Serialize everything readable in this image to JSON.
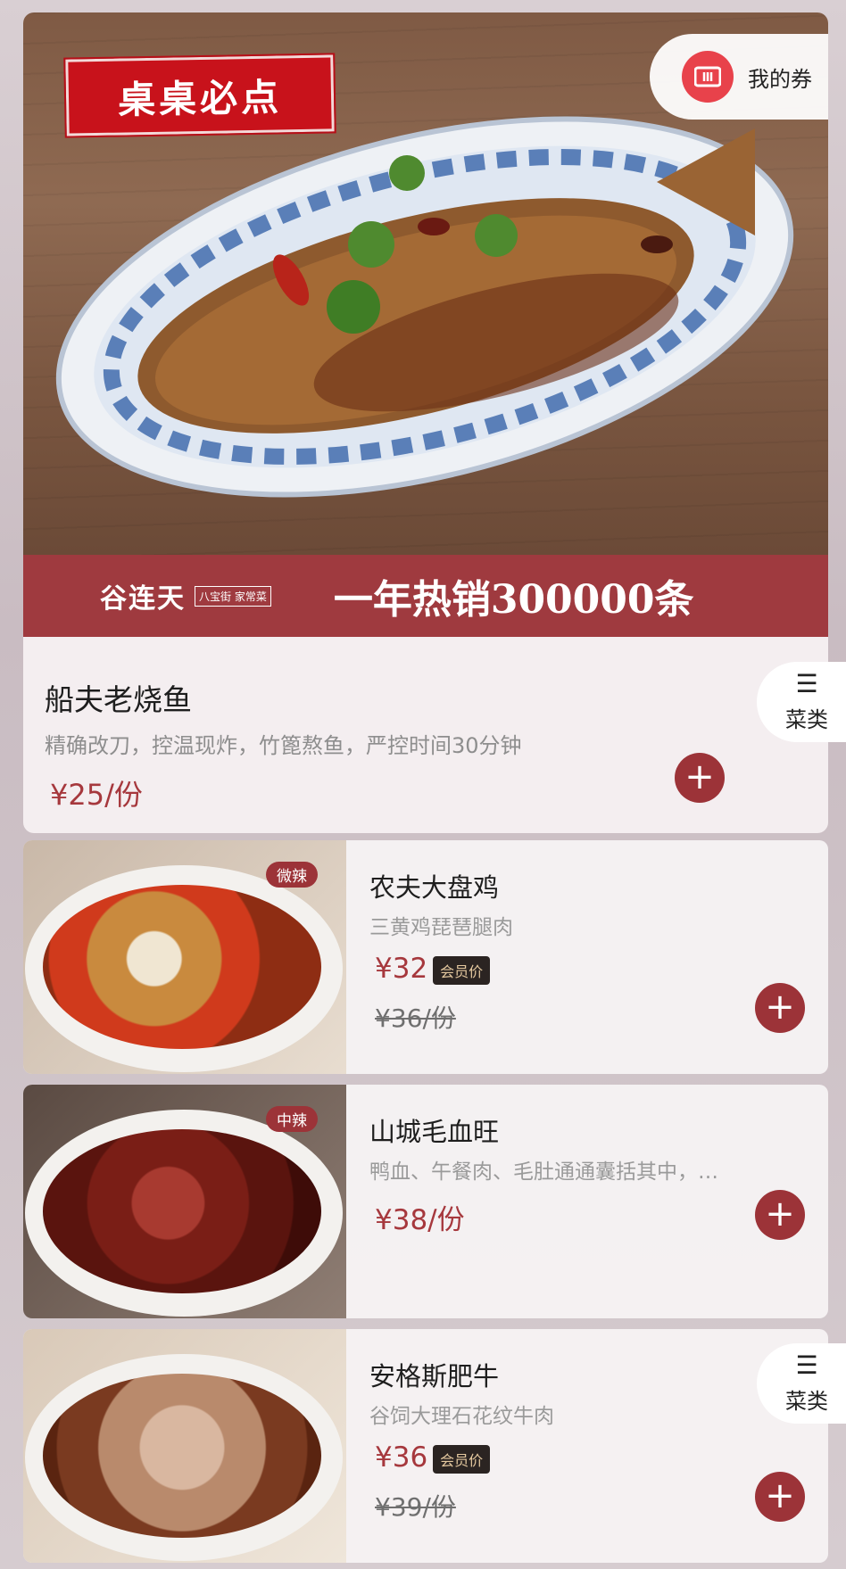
{
  "hero": {
    "tag": "桌桌必点",
    "coupon_label": "我的券",
    "coupon_icon": "ticket-icon",
    "brand": "谷连天",
    "brand_sub": "八宝街 家常菜",
    "slogan": "一年热销300000条",
    "name": "船夫老烧鱼",
    "desc": "精确改刀，控温现炸，竹篦熬鱼，严控时间30分钟",
    "price": "¥25/份"
  },
  "category_tab": {
    "label": "菜类",
    "icon": "list-icon"
  },
  "items": [
    {
      "name": "农夫大盘鸡",
      "desc": "三黄鸡琵琶腿肉",
      "spicy": "微辣",
      "price": "¥32",
      "member_label": "会员价",
      "orig_price": "¥36/份"
    },
    {
      "name": "山城毛血旺",
      "desc": "鸭血、午餐肉、毛肚通通囊括其中，…",
      "spicy": "中辣",
      "price": "¥38/份"
    },
    {
      "name": "安格斯肥牛",
      "desc": "谷饲大理石花纹牛肉",
      "price": "¥36",
      "member_label": "会员价",
      "orig_price": "¥39/份"
    }
  ],
  "add_symbol": "+",
  "colors": {
    "accent": "#9c3338",
    "price": "#a6383d",
    "tag_red": "#c8121b"
  }
}
